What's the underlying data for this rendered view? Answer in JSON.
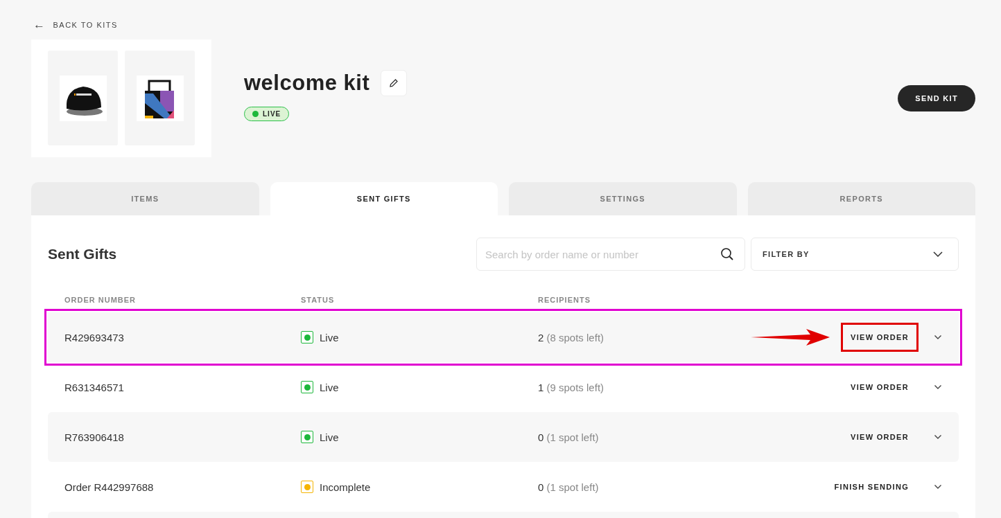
{
  "back_link": {
    "icon": "←",
    "label": "BACK TO KITS"
  },
  "kit": {
    "title": "welcome kit",
    "status": "LIVE",
    "products": [
      {
        "kind": "cap"
      },
      {
        "kind": "tote"
      }
    ]
  },
  "send_button": "SEND KIT",
  "tabs": [
    {
      "label": "ITEMS",
      "selected": false
    },
    {
      "label": "SENT GIFTS",
      "selected": true
    },
    {
      "label": "SETTINGS",
      "selected": false
    },
    {
      "label": "REPORTS",
      "selected": false
    }
  ],
  "section_title": "Sent Gifts",
  "search": {
    "placeholder": "Search by order name or number"
  },
  "filter": {
    "label": "FILTER BY"
  },
  "table": {
    "columns": [
      "ORDER NUMBER",
      "STATUS",
      "RECIPIENTS"
    ],
    "rows": [
      {
        "order": "R429693473",
        "status": "Live",
        "color": "#1db83b",
        "count": "2",
        "spots": "(8 spots left)",
        "action": "VIEW ORDER",
        "highlighted": true
      },
      {
        "order": "R631346571",
        "status": "Live",
        "color": "#1db83b",
        "count": "1",
        "spots": "(9 spots left)",
        "action": "VIEW ORDER",
        "highlighted": false
      },
      {
        "order": "R763906418",
        "status": "Live",
        "color": "#1db83b",
        "count": "0",
        "spots": "(1 spot left)",
        "action": "VIEW ORDER",
        "highlighted": false
      },
      {
        "order": "Order R442997688",
        "status": "Incomplete",
        "color": "#f5b400",
        "count": "0",
        "spots": "(1 spot left)",
        "action": "FINISH SENDING",
        "highlighted": false
      }
    ]
  }
}
